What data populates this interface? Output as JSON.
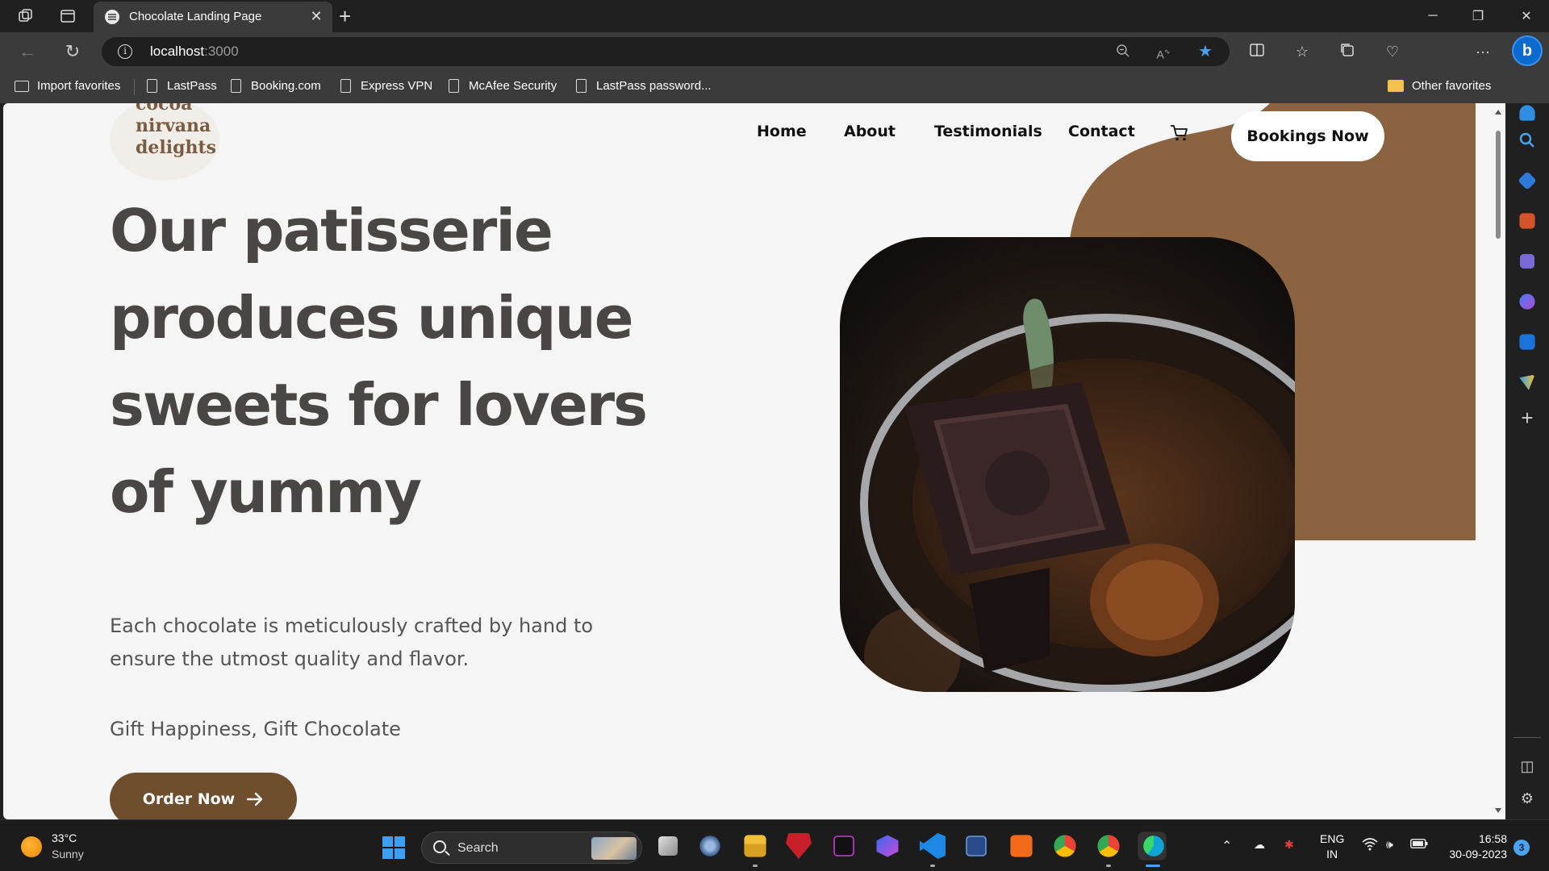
{
  "browser": {
    "tab_title": "Chocolate Landing Page",
    "url_host": "localhost",
    "url_port": ":3000",
    "favorites": [
      {
        "label": "Import favorites"
      },
      {
        "label": "LastPass"
      },
      {
        "label": "Booking.com"
      },
      {
        "label": "Express VPN"
      },
      {
        "label": "McAfee Security"
      },
      {
        "label": "LastPass password..."
      }
    ],
    "other_favorites": "Other favorites"
  },
  "page": {
    "logo_text": "cocoa\nnirvana\ndelights",
    "nav": [
      "Home",
      "About",
      "Testimonials",
      "Contact"
    ],
    "bookings_button": "Bookings Now",
    "headline": "Our patisserie produces unique sweets for lovers of yummy",
    "subtext": "Each chocolate is meticulously crafted by hand to ensure the utmost quality and flavor.",
    "tagline": "Gift Happiness, Gift Chocolate",
    "order_button": "Order Now",
    "colors": {
      "accent_brown": "#8b6340",
      "button_brown": "#6f4e2d",
      "background": "#f5f5f5",
      "headline_text": "#4a4646"
    }
  },
  "taskbar": {
    "weather_temp": "33°C",
    "weather_condition": "Sunny",
    "search_placeholder": "Search",
    "language_line1": "ENG",
    "language_line2": "IN",
    "time": "16:58",
    "date": "30-09-2023",
    "notification_count": "3"
  }
}
